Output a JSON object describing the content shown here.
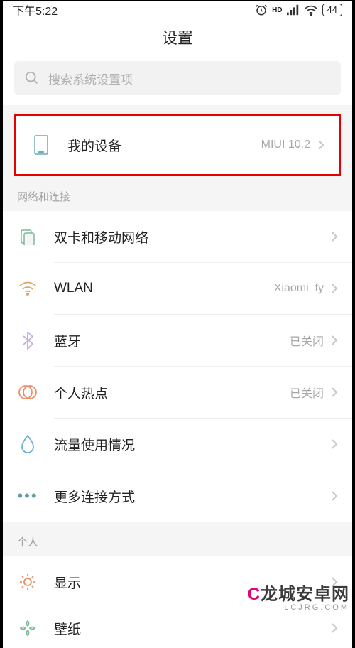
{
  "status": {
    "time": "下午5:22",
    "battery": "44"
  },
  "header": {
    "title": "设置"
  },
  "search": {
    "placeholder": "搜索系统设置项"
  },
  "my_device": {
    "label": "我的设备",
    "value": "MIUI 10.2"
  },
  "sections": {
    "network": {
      "header": "网络和连接",
      "dual_sim": "双卡和移动网络",
      "wlan": {
        "label": "WLAN",
        "value": "Xiaomi_fy"
      },
      "bluetooth": {
        "label": "蓝牙",
        "value": "已关闭"
      },
      "hotspot": {
        "label": "个人热点",
        "value": "已关闭"
      },
      "data_usage": "流量使用情况",
      "more": "更多连接方式"
    },
    "personal": {
      "header": "个人",
      "display": "显示",
      "wallpaper": "壁纸"
    }
  },
  "watermark": {
    "brand_prefix": "C",
    "brand_rest": "龙城安卓网",
    "sub": "LCJRG.COM"
  }
}
